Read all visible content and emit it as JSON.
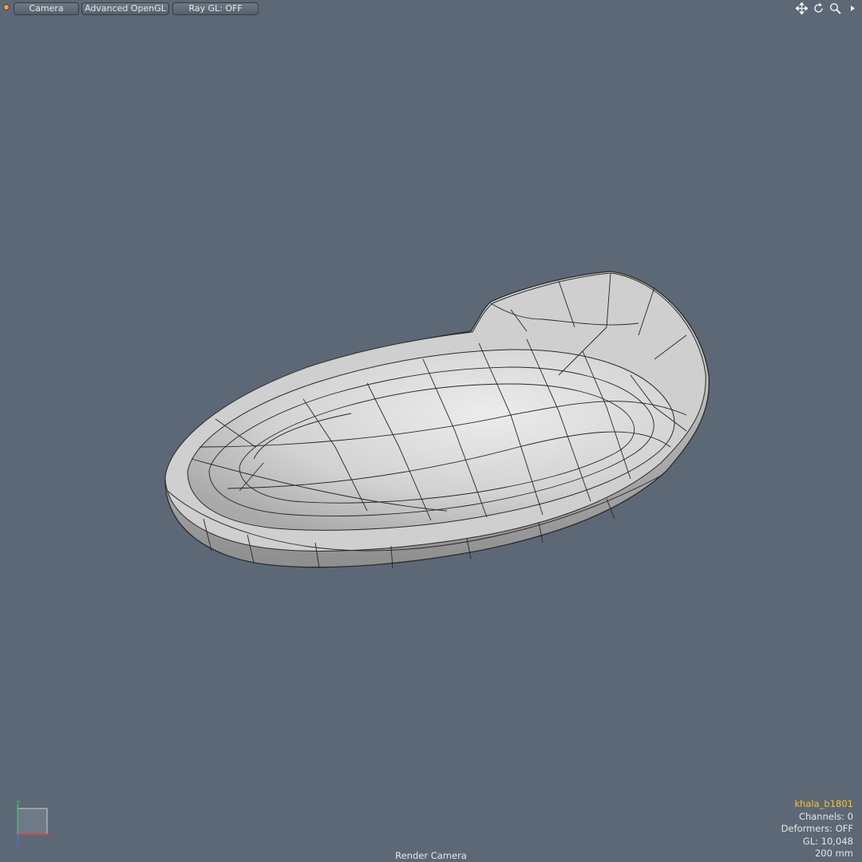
{
  "toolbar": {
    "camera_label": "Camera",
    "render_mode_label": "Advanced OpenGL",
    "raygl_label": "Ray GL: OFF",
    "nav_icons": [
      "move-icon",
      "rotate-icon",
      "zoom-icon",
      "expand-arrow-icon"
    ]
  },
  "axis": {
    "y_label": "Y",
    "z_label": "Z"
  },
  "info": {
    "item_name": "khala_b1801",
    "channels": "Channels: 0",
    "deformers": "Deformers: OFF",
    "gl_count": "GL: 10,048",
    "scale": "200 mm"
  },
  "viewport": {
    "camera_name": "Render Camera"
  },
  "colors": {
    "background": "#5d6876",
    "item_name": "#f0c23a",
    "text": "#e6e6e6",
    "x_axis": "#e04848",
    "y_axis": "#3fc060",
    "z_axis": "#4a6ae0"
  }
}
